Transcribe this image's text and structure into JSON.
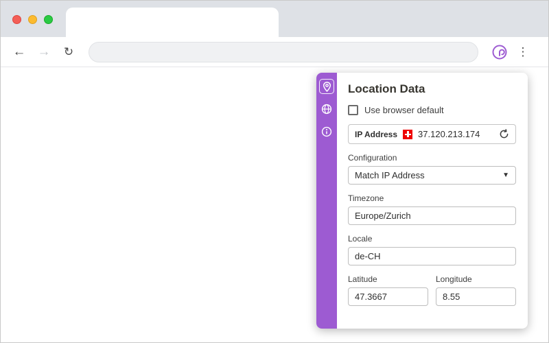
{
  "browser": {
    "back_icon": "back-arrow",
    "forward_icon": "forward-arrow",
    "reload_icon": "reload",
    "address_value": "",
    "extension_icon": "privacy-extension",
    "menu_icon": "kebab-menu",
    "menu_glyph": "⋮",
    "back_glyph": "←",
    "forward_glyph": "→",
    "reload_glyph": "↻"
  },
  "panel": {
    "title": "Location Data",
    "checkbox": {
      "label": "Use browser default",
      "checked": false
    },
    "ip": {
      "label": "IP Address",
      "value": "37.120.213.174",
      "flag": "switzerland-flag"
    },
    "configuration": {
      "label": "Configuration",
      "value": "Match IP Address",
      "caret": "▼"
    },
    "timezone": {
      "label": "Timezone",
      "value": "Europe/Zurich"
    },
    "locale": {
      "label": "Locale",
      "value": "de-CH"
    },
    "latitude": {
      "label": "Latitude",
      "value": "47.3667"
    },
    "longitude": {
      "label": "Longitude",
      "value": "8.55"
    },
    "sidebar_icons": [
      "location-pin",
      "globe",
      "info"
    ],
    "colors": {
      "accent": "#9d5bd2",
      "flag_red": "#ee0000"
    }
  }
}
